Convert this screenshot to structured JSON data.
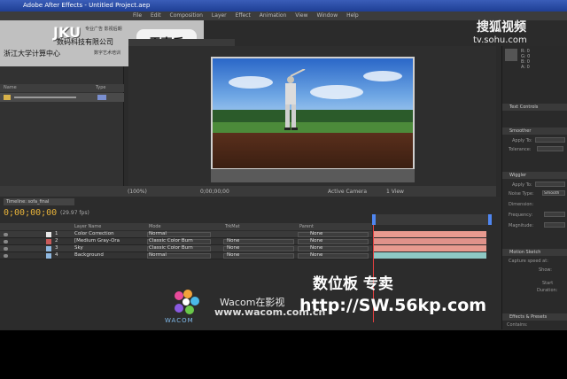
{
  "window": {
    "title": "Adobe After Effects - Untitled Project.aep",
    "menus": [
      "File",
      "Edit",
      "Composition",
      "Layer",
      "Effect",
      "Animation",
      "View",
      "Window",
      "Help"
    ]
  },
  "overlay": {
    "jku": "JKU",
    "company": "数码科技有限公司",
    "small_text": "专业广告 影视后期",
    "center": "浙江大学计算中心",
    "center_sub": "数字艺术培训",
    "name": "王嘉乐"
  },
  "watermark": {
    "brand": "搜狐视频",
    "url": "tv.sohu.com"
  },
  "project": {
    "columns": [
      "Name",
      "Type"
    ],
    "rows": [
      {
        "name": "Comp",
        "type": "Folder"
      }
    ]
  },
  "viewer": {
    "zoom": "(100%)",
    "timecode": "0;00;00;00",
    "camera": "Active Camera",
    "view": "1 View"
  },
  "timeline": {
    "tab": "Timeline: sofa_final",
    "timecode": "0;00;00;00",
    "fps": "(29.97 fps)",
    "columns": [
      "Layer Name",
      "Mode",
      "TrkMat",
      "Parent"
    ],
    "layers": [
      {
        "num": "1",
        "name": "Color Correction",
        "mode": "Normal",
        "trkmat": "",
        "parent": "None",
        "color": "#e8e8e8"
      },
      {
        "num": "2",
        "name": "[Medium Gray-Ora",
        "mode": "Classic Color Burn",
        "trkmat": "None",
        "parent": "None",
        "color": "#c85a5a"
      },
      {
        "num": "3",
        "name": "Sky",
        "mode": "Classic Color Burn",
        "trkmat": "None",
        "parent": "None",
        "color": "#8fb8e0"
      },
      {
        "num": "4",
        "name": "Background",
        "mode": "Normal",
        "trkmat": "None",
        "parent": "None",
        "color": "#8fb8e0"
      }
    ],
    "track_colors": [
      "#e89a8f",
      "#e0928a",
      "#e89a8f",
      "#8ec8c4"
    ]
  },
  "right_panels": {
    "info": [
      "R: 0",
      "G: 0",
      "B: 0",
      "A: 0"
    ],
    "text_controls": "Text Controls",
    "smoother": {
      "title": "Smoother",
      "apply_to": "Apply To:",
      "tolerance": "Tolerance:"
    },
    "wiggler": {
      "title": "Wiggler",
      "apply_to": "Apply To:",
      "noise_type": "Noise Type:",
      "dimension": "Dimension:",
      "frequency": "Frequency:",
      "magnitude": "Magnitude:",
      "noise_value": "Smooth"
    },
    "motion_sketch": {
      "title": "Motion Sketch",
      "capture_speed": "Capture speed at:",
      "show": "Show:",
      "start": "Start",
      "duration": "Duration:"
    },
    "effects": {
      "title": "Effects & Presets",
      "contains": "Contains:"
    }
  },
  "ad": {
    "title": "数位板 专卖",
    "url": "http://SW.56kp.com",
    "wacom_text": "Wacom在影视",
    "wacom_url": "www.wacom.com.cn",
    "wacom_brand": "WACOM"
  }
}
